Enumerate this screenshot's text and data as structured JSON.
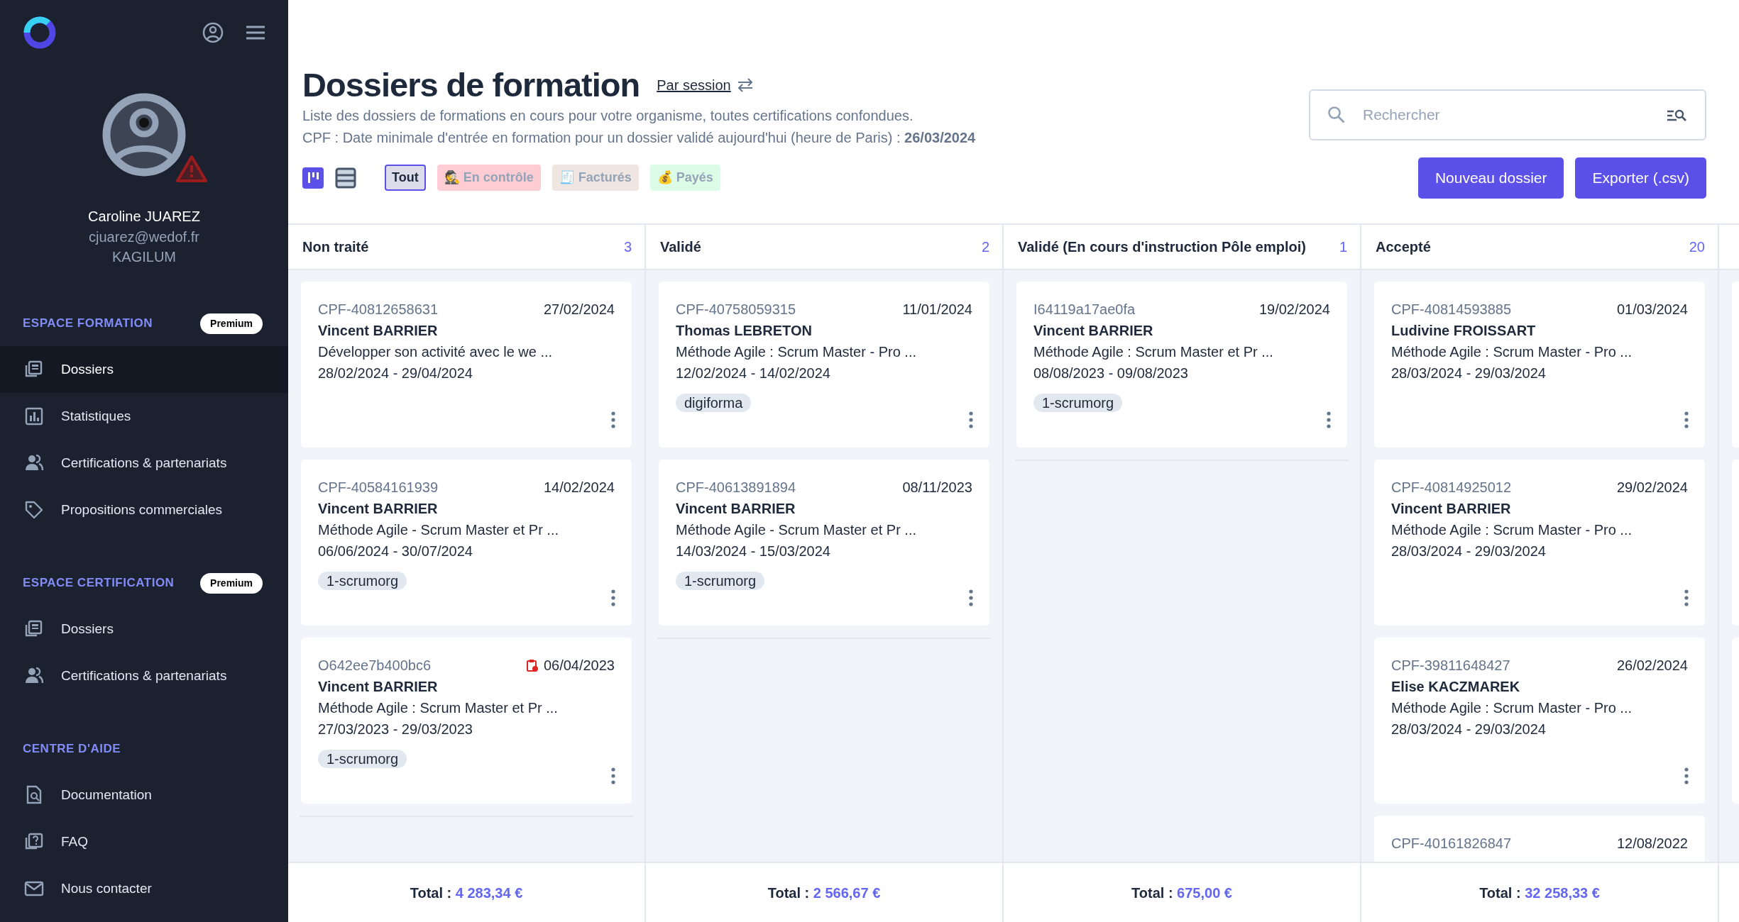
{
  "sidebar": {
    "user": {
      "name": "Caroline JUAREZ",
      "email": "cjuarez@wedof.fr",
      "organization": "KAGILUM",
      "warning": true
    },
    "sections": [
      {
        "title": "ESPACE FORMATION",
        "badge": "Premium",
        "items": [
          {
            "kind": "dossiers",
            "label": "Dossiers",
            "selected": true
          },
          {
            "kind": "stats",
            "label": "Statistiques",
            "selected": false
          },
          {
            "kind": "people",
            "label": "Certifications & partenariats",
            "selected": false
          },
          {
            "kind": "tag",
            "label": "Propositions commerciales",
            "selected": false
          }
        ]
      },
      {
        "title": "ESPACE CERTIFICATION",
        "badge": "Premium",
        "items": [
          {
            "kind": "dossiers",
            "label": "Dossiers",
            "selected": false
          },
          {
            "kind": "people",
            "label": "Certifications & partenariats",
            "selected": false
          }
        ]
      },
      {
        "title": "CENTRE D'AIDE",
        "items": [
          {
            "kind": "doc",
            "label": "Documentation",
            "selected": false
          },
          {
            "kind": "faq",
            "label": "FAQ",
            "selected": false
          },
          {
            "kind": "mail",
            "label": "Nous contacter",
            "selected": false
          }
        ]
      }
    ]
  },
  "header": {
    "title": "Dossiers de formation",
    "view_switch": "Par session",
    "description": "Liste des dossiers de formations en cours pour votre organisme, toutes certifications confondues.",
    "cpf_note": "CPF : Date minimale d'entrée en formation pour un dossier validé aujourd'hui (heure de Paris) : **26/03/2024**"
  },
  "views": [
    {
      "kind": "kanban",
      "selected": true
    },
    {
      "kind": "list",
      "selected": false
    }
  ],
  "filters": [
    {
      "label": "Tout",
      "selected": true
    },
    {
      "emoji": "🕵",
      "label": "En contrôle",
      "color": "#fecdd3",
      "selected": false
    },
    {
      "emoji": "🧾",
      "label": "Facturés",
      "color": "#efe6e1",
      "selected": false
    },
    {
      "emoji": "💰",
      "label": "Payés",
      "color": "#dcfce7",
      "selected": false
    }
  ],
  "search": {
    "placeholder": "Rechercher"
  },
  "buttons": [
    "Nouveau dossier",
    "Exporter (.csv)"
  ],
  "columns": [
    {
      "title": "Non traité",
      "count": "3",
      "total_label": "Total :",
      "total": "4 283,34 €",
      "cards": [
        {
          "id": "CPF-40812658631",
          "date": "27/02/2024",
          "name": "Vincent BARRIER",
          "training": "Développer son activité avec le we ...",
          "period": "28/02/2024 - 29/04/2024"
        },
        {
          "id": "CPF-40584161939",
          "date": "14/02/2024",
          "name": "Vincent BARRIER",
          "training": "Méthode Agile - Scrum Master et Pr ...",
          "period": "06/06/2024 - 30/07/2024",
          "tag": "1-scrumorg"
        },
        {
          "id": "O642ee7b400bc6",
          "date": "06/04/2023",
          "date_alert": true,
          "name": "Vincent BARRIER",
          "training": "Méthode Agile : Scrum Master et Pr ...",
          "period": "27/03/2023 - 29/03/2023",
          "tag": "1-scrumorg"
        }
      ]
    },
    {
      "title": "Validé",
      "count": "2",
      "total_label": "Total :",
      "total": "2 566,67 €",
      "cards": [
        {
          "id": "CPF-40758059315",
          "date": "11/01/2024",
          "name": "Thomas LEBRETON",
          "training": "Méthode Agile : Scrum Master - Pro ...",
          "period": "12/02/2024 - 14/02/2024",
          "tag": "digiforma"
        },
        {
          "id": "CPF-40613891894",
          "date": "08/11/2023",
          "name": "Vincent BARRIER",
          "training": "Méthode Agile - Scrum Master et Pr ...",
          "period": "14/03/2024 - 15/03/2024",
          "tag": "1-scrumorg"
        }
      ]
    },
    {
      "title": "Validé (En cours d'instruction Pôle emploi)",
      "count": "1",
      "total_label": "Total :",
      "total": "675,00 €",
      "cards": [
        {
          "id": "I64119a17ae0fa",
          "date": "19/02/2024",
          "name": "Vincent BARRIER",
          "training": "Méthode Agile : Scrum Master et Pr ...",
          "period": "08/08/2023 - 09/08/2023",
          "tag": "1-scrumorg"
        }
      ]
    },
    {
      "title": "Accepté",
      "count": "20",
      "total_label": "Total :",
      "total": "32 258,33 €",
      "cards": [
        {
          "id": "CPF-40814593885",
          "date": "01/03/2024",
          "name": "Ludivine FROISSART",
          "training": "Méthode Agile : Scrum Master - Pro ...",
          "period": "28/03/2024 - 29/03/2024"
        },
        {
          "id": "CPF-40814925012",
          "date": "29/02/2024",
          "name": "Vincent BARRIER",
          "training": "Méthode Agile : Scrum Master - Pro ...",
          "period": "28/03/2024 - 29/03/2024"
        },
        {
          "id": "CPF-39811648427",
          "date": "26/02/2024",
          "name": "Elise KACZMAREK",
          "training": "Méthode Agile : Scrum Master - Pro ...",
          "period": "28/03/2024 - 29/03/2024"
        },
        {
          "id": "CPF-40161826847",
          "date": "12/08/2022"
        }
      ]
    }
  ]
}
